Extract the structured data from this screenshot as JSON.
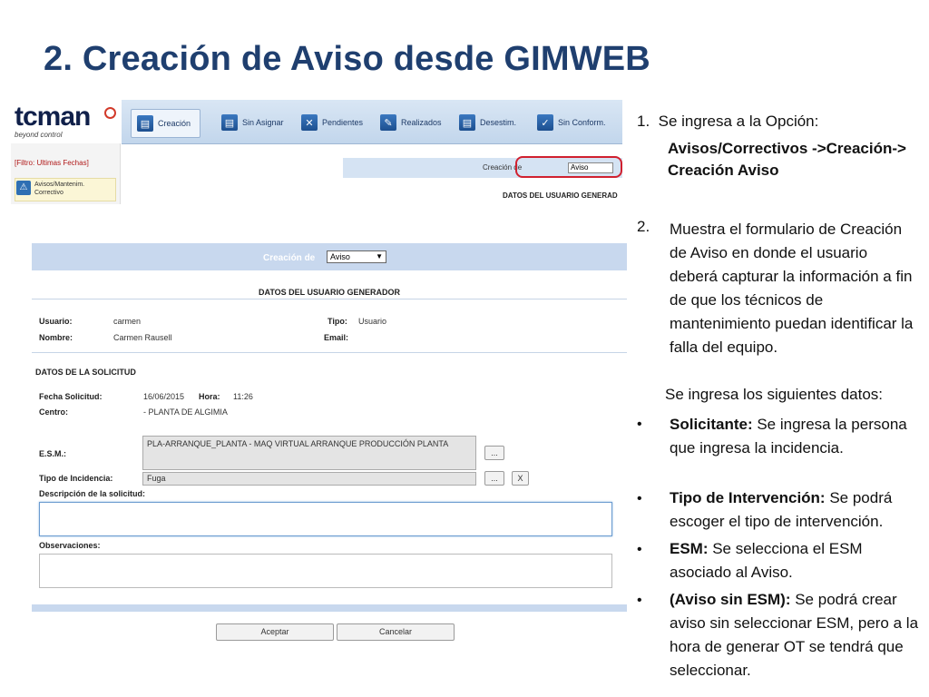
{
  "slide_title": "2.  Creación de Aviso desde GIMWEB",
  "app_top": {
    "logo": "tcman",
    "slogan": "beyond control",
    "tabs": [
      "Creación",
      "Sin Asignar",
      "Pendientes",
      "Realizados",
      "Desestim.",
      "Sin Conform."
    ],
    "filter_link": "[Filtro: Ultimas Fechas]",
    "side_item": "Avisos/Mantenim. Correctivo",
    "mini_creacion_label": "Creación de",
    "mini_select_value": "Aviso",
    "mini_datos_header": "DATOS DEL USUARIO GENERAD"
  },
  "form": {
    "creacion_label": "Creación de",
    "tipo_select": "Aviso",
    "datos_usuario_header": "DATOS DEL USUARIO GENERADOR",
    "usuario_label": "Usuario:",
    "usuario_value": "carmen",
    "nombre_label": "Nombre:",
    "nombre_value": "Carmen Rausell",
    "tipo_label": "Tipo:",
    "tipo_value": "Usuario",
    "email_label": "Email:",
    "datos_solicitud_header": "DATOS DE LA SOLICITUD",
    "fecha_label": "Fecha Solicitud:",
    "fecha_value": "16/06/2015",
    "hora_label": "Hora:",
    "hora_value": "11:26",
    "centro_label": "Centro:",
    "centro_value": "- PLANTA DE ALGIMIA",
    "esm_label": "E.S.M.:",
    "esm_value": "PLA-ARRANQUE_PLANTA - MAQ VIRTUAL ARRANQUE PRODUCCIÓN PLANTA",
    "incidencia_label": "Tipo de Incidencia:",
    "incidencia_value": "Fuga",
    "lookup_button": "...",
    "clear_button": "X",
    "descripcion_label": "Descripción de la solicitud:",
    "observaciones_label": "Observaciones:",
    "aceptar_button": "Aceptar",
    "cancelar_button": "Cancelar"
  },
  "instructions": {
    "step1_num": "1.",
    "step1_text": "Se ingresa a la Opción:",
    "step1_path": "Avisos/Correctivos ->Creación-> Creación Aviso",
    "step2_num": "2.",
    "step2_text": "Muestra el formulario de Creación de Aviso en donde  el usuario deberá capturar la información a fin de que los técnicos de mantenimiento puedan identificar la falla del equipo.",
    "datos_intro": "Se ingresa los siguientes datos:",
    "bullets": [
      {
        "bold": " Solicitante:",
        "text": " Se ingresa  la persona que ingresa la incidencia."
      },
      {
        "bold": "Tipo de Intervención:",
        "text": " Se podrá escoger el tipo de intervención."
      },
      {
        "bold": "ESM:",
        "text": " Se selecciona el ESM asociado al Aviso."
      },
      {
        "bold": "(Aviso sin ESM):",
        "text": " Se podrá crear aviso sin seleccionar ESM, pero a la hora de generar OT se tendrá que seleccionar."
      }
    ]
  }
}
